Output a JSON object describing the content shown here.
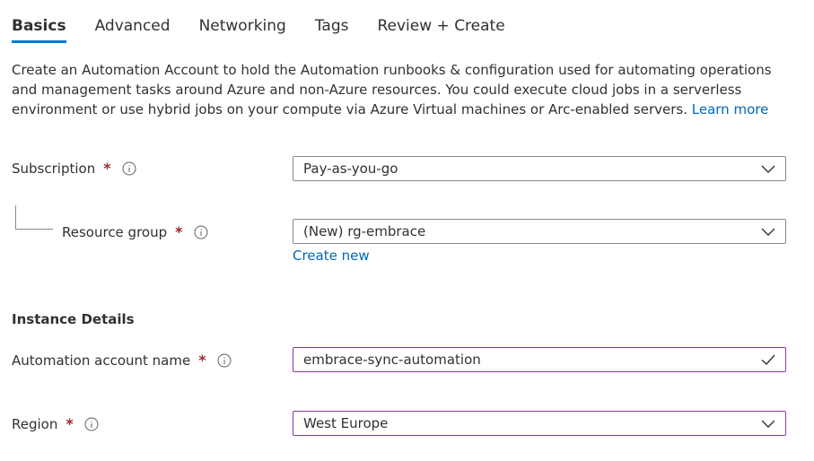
{
  "tabs": [
    {
      "label": "Basics",
      "active": true
    },
    {
      "label": "Advanced",
      "active": false
    },
    {
      "label": "Networking",
      "active": false
    },
    {
      "label": "Tags",
      "active": false
    },
    {
      "label": "Review + Create",
      "active": false
    }
  ],
  "description": {
    "text": "Create an Automation Account to hold the Automation runbooks & configuration used for automating operations and management tasks around Azure and non-Azure resources. You could execute cloud jobs in a serverless environment or use hybrid jobs on your compute via Azure Virtual machines or Arc-enabled servers.",
    "link_label": "Learn more"
  },
  "form": {
    "required_marker": "*",
    "subscription": {
      "label": "Subscription",
      "value": "Pay-as-you-go"
    },
    "resource_group": {
      "label": "Resource group",
      "value": "(New) rg-embrace",
      "create_new": "Create new"
    },
    "instance_details_title": "Instance Details",
    "account_name": {
      "label": "Automation account name",
      "value": "embrace-sync-automation"
    },
    "region": {
      "label": "Region",
      "value": "West Europe"
    }
  },
  "colors": {
    "accent": "#0078d4",
    "link": "#0067b8",
    "required": "#a4262c",
    "focus_border": "#8a3b9e",
    "valid_check": "#323130"
  }
}
